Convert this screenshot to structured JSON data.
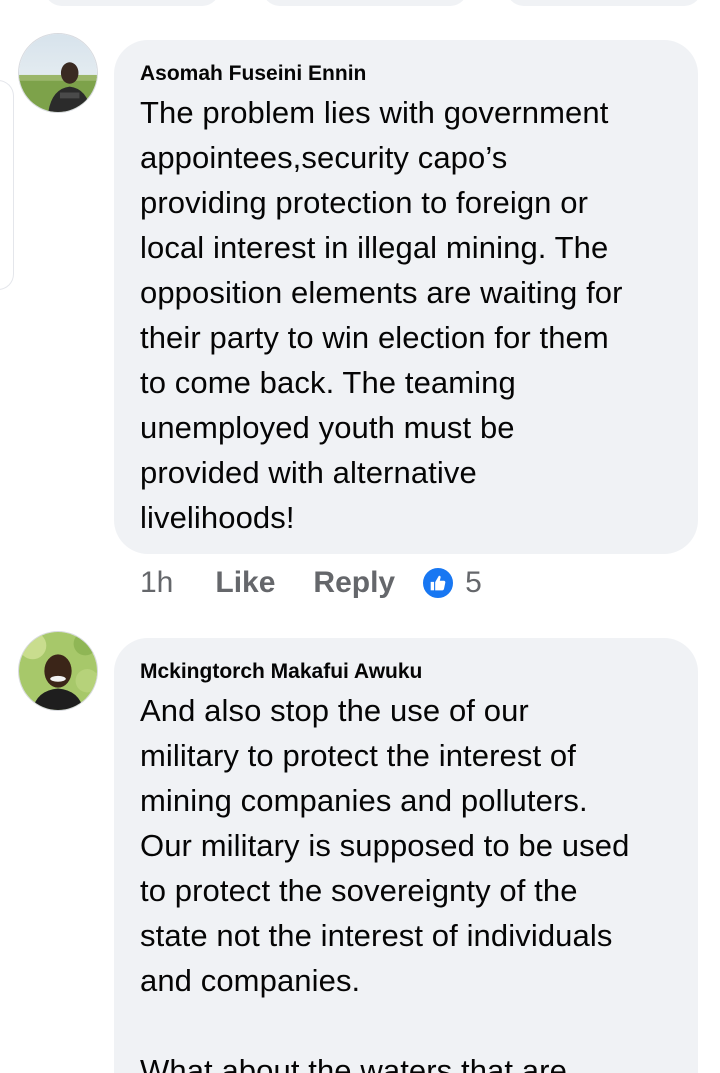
{
  "comments": [
    {
      "author": "Asomah Fuseini Ennin",
      "text": "The problem lies with government\nappointees,security capo’s\nproviding protection to foreign or\nlocal interest in illegal mining. The\nopposition elements are waiting for\ntheir party to win election for them\nto come back. The teaming\nunemployed youth must be\nprovided with alternative\nlivelihoods!",
      "time": "1h",
      "like_label": "Like",
      "reply_label": "Reply",
      "reaction_icon": "like-icon",
      "reaction_count": "5"
    },
    {
      "author": "Mckingtorch Makafui Awuku",
      "text": "And also stop the use of our\nmilitary to protect the interest of\nmining companies and polluters.\nOur military is supposed to be used\nto protect the sovereignty of the\nstate not the interest of individuals\nand companies.\n\nWhat about the waters that are"
    }
  ],
  "colors": {
    "bubble": "#f0f2f5",
    "meta_text": "#65676b",
    "like_blue": "#1877f2"
  }
}
